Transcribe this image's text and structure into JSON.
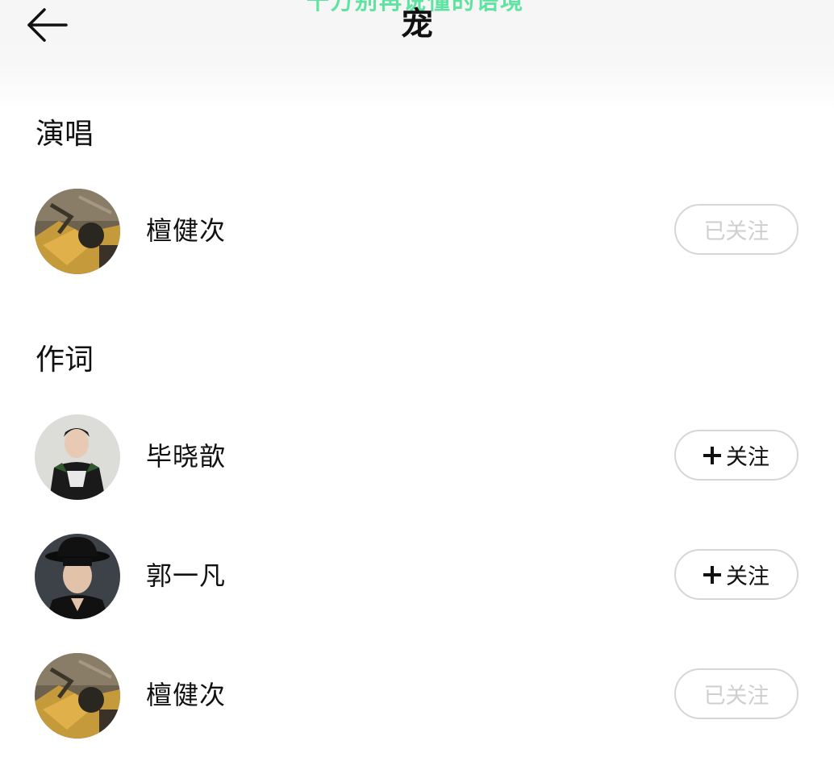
{
  "header": {
    "title": "宠",
    "ghost_text": "千万别再说懂的语境",
    "back_icon": "arrow-left-icon"
  },
  "sections": [
    {
      "title": "演唱",
      "people": [
        {
          "name": "檀健次",
          "follow_label": "已关注",
          "followed": true
        }
      ]
    },
    {
      "title": "作词",
      "people": [
        {
          "name": "毕晓歆",
          "follow_label": "关注",
          "followed": false
        },
        {
          "name": "郭一凡",
          "follow_label": "关注",
          "followed": false
        },
        {
          "name": "檀健次",
          "follow_label": "已关注",
          "followed": true
        }
      ]
    }
  ],
  "colors": {
    "followed_text": "#cfcfcf",
    "button_border": "#d6d6d6",
    "accent_green": "#5fe3a1"
  }
}
